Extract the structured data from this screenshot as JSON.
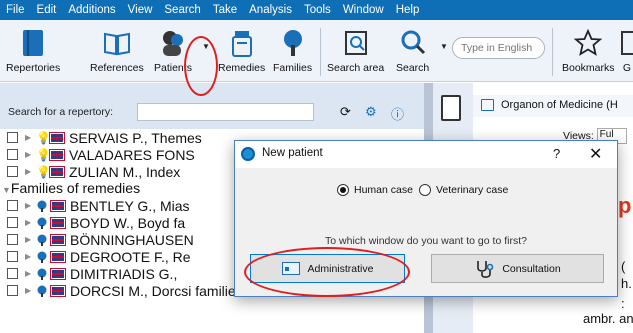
{
  "menu": [
    "File",
    "Edit",
    "Additions",
    "View",
    "Search",
    "Take",
    "Analysis",
    "Tools",
    "Window",
    "Help"
  ],
  "toolbar": {
    "repertories": "Repertories",
    "references": "References",
    "patients": "Patients",
    "remedies": "Remedies",
    "families": "Families",
    "search_area": "Search area",
    "search": "Search",
    "search_placeholder": "Type in English",
    "bookmarks": "Bookmarks",
    "cut_label": "G"
  },
  "left": {
    "search_label": "Search for a repertory:",
    "rows_top": [
      {
        "name": "SERVAIS P., Themes"
      },
      {
        "name": "VALADARES FONS"
      },
      {
        "name": "ZULIAN M., Index"
      }
    ],
    "group": "Families of remedies",
    "rows_family": [
      {
        "name": "BENTLEY G., Mias"
      },
      {
        "name": "BOYD W., Boyd fa"
      },
      {
        "name": "BÖNNINGHAUSEN"
      },
      {
        "name": "DEGROOTE F., Re"
      },
      {
        "name": "DIMITRIADIS G., "
      },
      {
        "name": "DORCSI M., Dorcsi families"
      }
    ]
  },
  "right": {
    "title": "Organon of Medicine (H",
    "views_label": "Views:",
    "views_value": "Ful",
    "red_text": "p",
    "t1": "(",
    "t2": "h.",
    "t3": ":",
    "ambi": "ambr. anac. a"
  },
  "dialog": {
    "title": "New patient",
    "help": "?",
    "close": "✕",
    "radio_human": "Human case",
    "radio_vet": "Veterinary case",
    "question": "To which window do you want to go to first?",
    "btn_admin": "Administrative",
    "btn_consult": "Consultation"
  },
  "colors": {
    "menubar": "#0f6fb6",
    "annotation": "#e01e1e"
  }
}
